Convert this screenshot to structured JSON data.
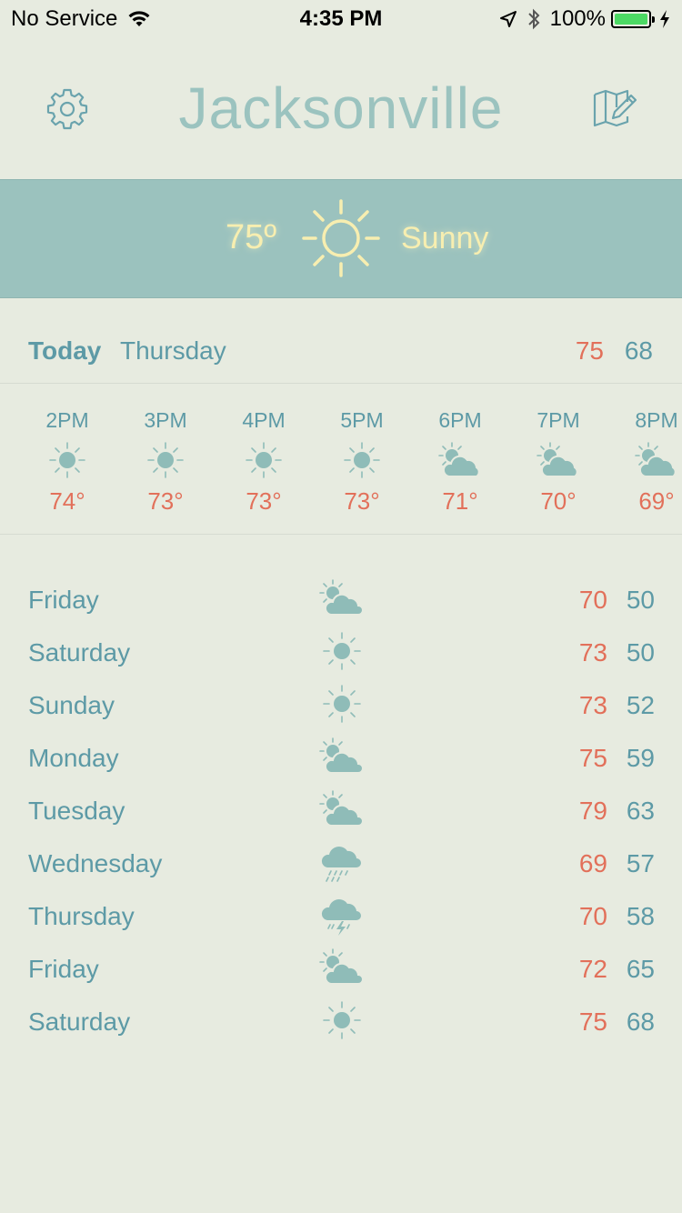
{
  "status_bar": {
    "carrier": "No Service",
    "time": "4:35 PM",
    "battery": "100%",
    "battery_color": "#4cd964"
  },
  "header": {
    "city": "Jacksonville",
    "left_icon": "gear-icon",
    "right_icon": "map-edit-icon"
  },
  "current": {
    "temp": "75º",
    "condition": "Sunny",
    "icon": "sun-icon"
  },
  "today": {
    "label": "Today",
    "day": "Thursday",
    "high": "75",
    "low": "68"
  },
  "hourly": [
    {
      "time": "2PM",
      "temp": "74°",
      "icon": "sun-icon"
    },
    {
      "time": "3PM",
      "temp": "73°",
      "icon": "sun-icon"
    },
    {
      "time": "4PM",
      "temp": "73°",
      "icon": "sun-icon"
    },
    {
      "time": "5PM",
      "temp": "73°",
      "icon": "sun-icon"
    },
    {
      "time": "6PM",
      "temp": "71°",
      "icon": "partly-cloudy-icon"
    },
    {
      "time": "7PM",
      "temp": "70°",
      "icon": "partly-cloudy-icon"
    },
    {
      "time": "8PM",
      "temp": "69°",
      "icon": "partly-cloudy-icon"
    }
  ],
  "daily": [
    {
      "day": "Friday",
      "high": "70",
      "low": "50",
      "icon": "partly-cloudy-icon"
    },
    {
      "day": "Saturday",
      "high": "73",
      "low": "50",
      "icon": "sun-icon"
    },
    {
      "day": "Sunday",
      "high": "73",
      "low": "52",
      "icon": "sun-icon"
    },
    {
      "day": "Monday",
      "high": "75",
      "low": "59",
      "icon": "partly-cloudy-icon"
    },
    {
      "day": "Tuesday",
      "high": "79",
      "low": "63",
      "icon": "partly-cloudy-icon"
    },
    {
      "day": "Wednesday",
      "high": "69",
      "low": "57",
      "icon": "rain-icon"
    },
    {
      "day": "Thursday",
      "high": "70",
      "low": "58",
      "icon": "thunderstorm-icon"
    },
    {
      "day": "Friday",
      "high": "72",
      "low": "65",
      "icon": "partly-cloudy-icon"
    },
    {
      "day": "Saturday",
      "high": "75",
      "low": "68",
      "icon": "sun-icon"
    }
  ],
  "colors": {
    "background": "#e7ebe0",
    "accent": "#9bc2be",
    "text": "#5d9aa6",
    "high": "#e2705a",
    "current_text": "#f7eeb0"
  }
}
